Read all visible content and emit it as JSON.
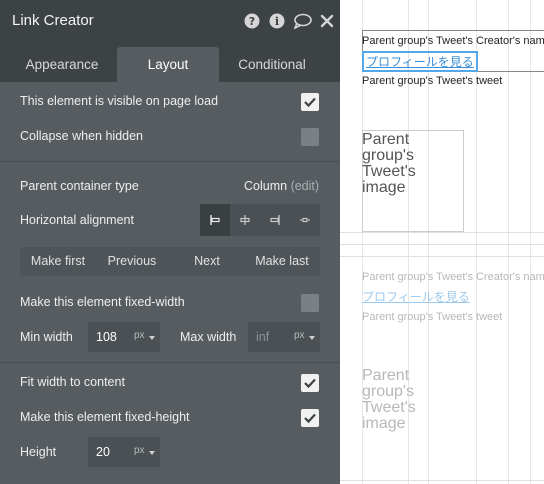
{
  "panel": {
    "title": "Link Creator",
    "icons": [
      "help-icon",
      "info-icon",
      "comment-icon",
      "close-icon"
    ],
    "tabs": [
      {
        "label": "Appearance",
        "active": false
      },
      {
        "label": "Layout",
        "active": true
      },
      {
        "label": "Conditional",
        "active": false
      }
    ],
    "visible_on_load": {
      "label": "This element is visible on page load",
      "checked": true
    },
    "collapse_when_hidden": {
      "label": "Collapse when hidden",
      "checked": false
    },
    "parent_container": {
      "label": "Parent container type",
      "value": "Column",
      "edit_label": "(edit)"
    },
    "horizontal_alignment": {
      "label": "Horizontal alignment",
      "options": [
        "align-left-icon",
        "align-center-icon",
        "align-right-icon",
        "align-distribute-icon"
      ],
      "selected": "align-left-icon"
    },
    "nav_buttons": [
      "Make first",
      "Previous",
      "Next",
      "Make last"
    ],
    "fixed_width": {
      "label": "Make this element fixed-width",
      "checked": false
    },
    "min_width": {
      "label": "Min width",
      "value": "108",
      "unit": "px"
    },
    "max_width": {
      "label": "Max width",
      "placeholder": "inf",
      "unit": "px"
    },
    "fit_width": {
      "label": "Fit width to content",
      "checked": true
    },
    "fixed_height": {
      "label": "Make this element fixed-height",
      "checked": true
    },
    "height": {
      "label": "Height",
      "value": "20",
      "unit": "px"
    },
    "colors": {
      "panel_bg": "#565c5f",
      "titlebar_bg": "#3d4245",
      "link": "#3a8fd8",
      "selection": "#52a8e8"
    }
  },
  "canvas": {
    "row1": {
      "creator_text": "Parent group's Tweet's Creator's name",
      "link_text": "プロフィールを見る",
      "tweet_text": "Parent group's Tweet's tweet",
      "image_label": "Parent group's Tweet's image"
    },
    "row2": {
      "creator_text": "Parent group's Tweet's Creator's name",
      "link_text": "プロフィールを見る",
      "tweet_text": "Parent group's Tweet's tweet",
      "image_label": "Parent group's Tweet's image"
    }
  }
}
